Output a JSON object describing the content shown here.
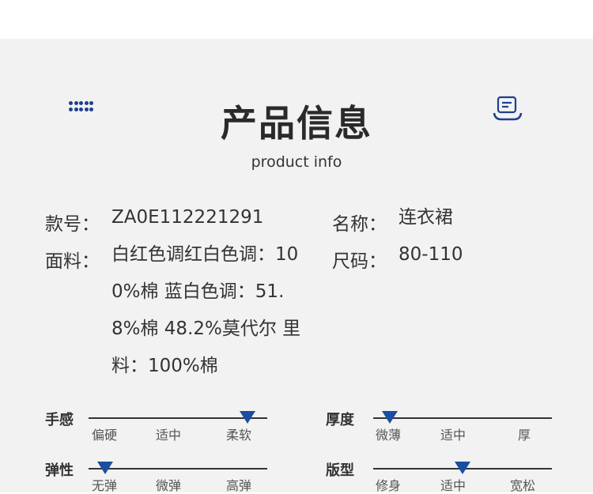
{
  "header": {
    "title": "产品信息",
    "subtitle": "product info",
    "menu_icon": "dots-grid-icon",
    "note_icon": "message-note-icon",
    "accent": "#1e3f8f"
  },
  "info": {
    "style_no_label": "款号：",
    "style_no_value": "ZA0E112221291",
    "name_label": "名称：",
    "name_value": "连衣裙",
    "fabric_label": "面料：",
    "fabric_value": "白红色调红白色调：100%棉 蓝白色调：51.8%棉 48.2%莫代尔 里料：100%棉",
    "size_label": "尺码：",
    "size_value": "80-110"
  },
  "scales": {
    "hand_feel": {
      "label": "手感",
      "options": [
        "偏硬",
        "适中",
        "柔软"
      ],
      "selected": "柔软"
    },
    "thickness": {
      "label": "厚度",
      "options": [
        "微薄",
        "适中",
        "厚"
      ],
      "selected": "微薄"
    },
    "elasticity": {
      "label": "弹性",
      "options": [
        "无弹",
        "微弹",
        "高弹"
      ],
      "selected": "无弹"
    },
    "fit": {
      "label": "版型",
      "options": [
        "修身",
        "适中",
        "宽松"
      ],
      "selected": "适中"
    }
  }
}
